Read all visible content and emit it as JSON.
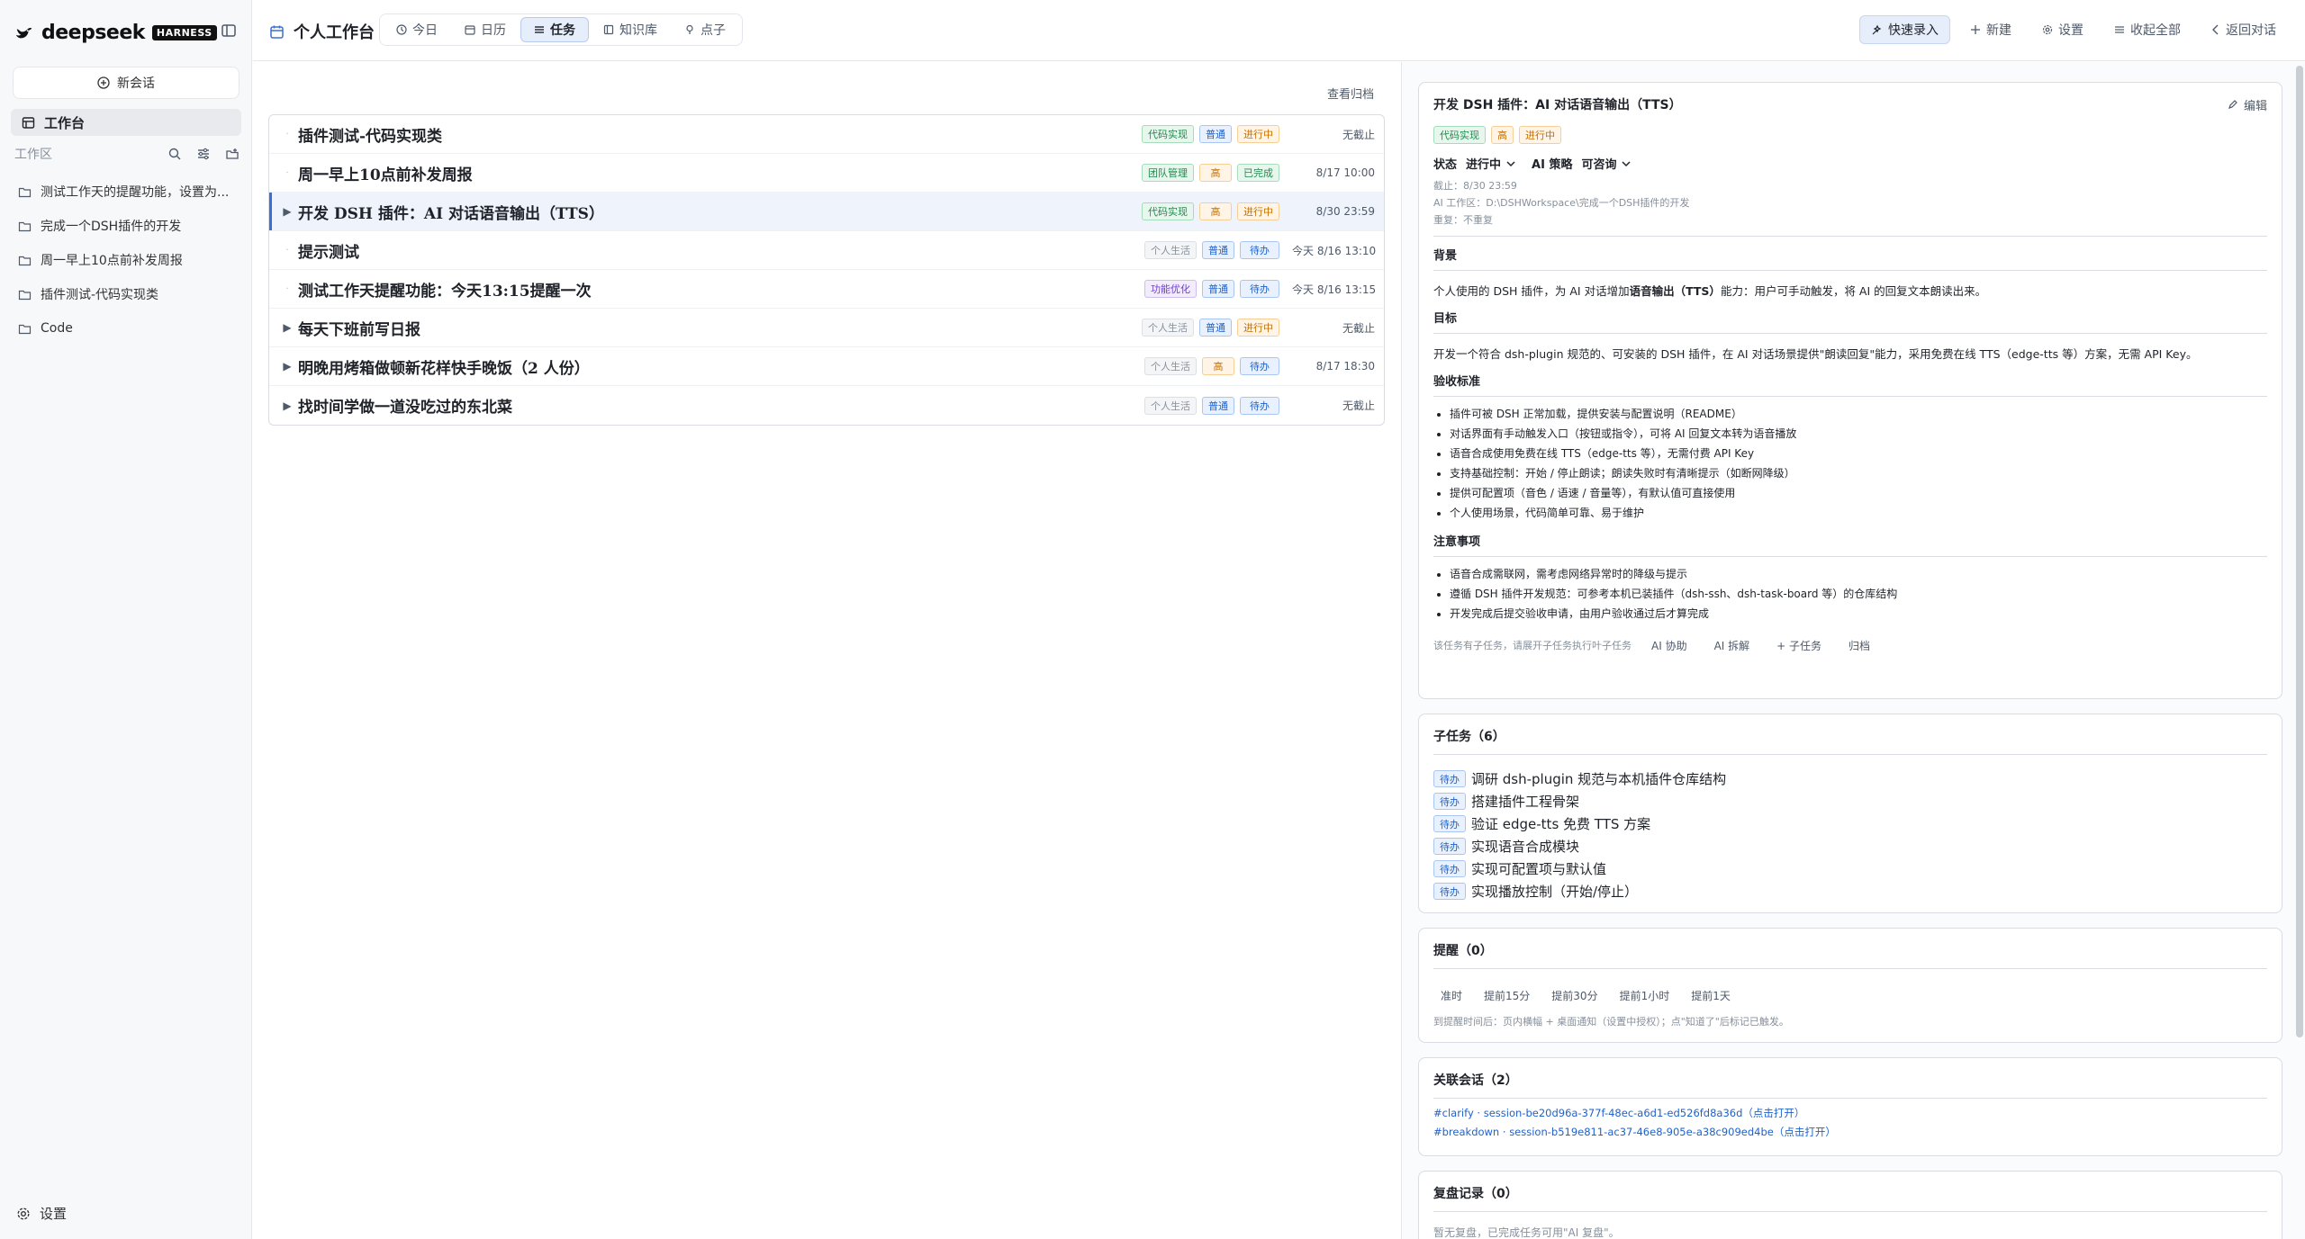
{
  "brand": {
    "name": "deepseek",
    "badge": "HARNESS"
  },
  "sidebar": {
    "new_chat": "新会话",
    "workbench": "工作台",
    "workspace_label": "工作区",
    "items": [
      {
        "label": "测试工作天的提醒功能，设置为..."
      },
      {
        "label": "完成一个DSH插件的开发"
      },
      {
        "label": "周一早上10点前补发周报"
      },
      {
        "label": "插件测试-代码实现类"
      },
      {
        "label": "Code"
      }
    ],
    "settings": "设置"
  },
  "header": {
    "title": "个人工作台",
    "tabs": [
      {
        "label": "今日",
        "icon": "clock-icon"
      },
      {
        "label": "日历",
        "icon": "calendar-icon"
      },
      {
        "label": "任务",
        "icon": "list-icon",
        "active": true
      },
      {
        "label": "知识库",
        "icon": "book-icon"
      },
      {
        "label": "点子",
        "icon": "bulb-icon"
      }
    ],
    "actions": {
      "quick_entry": "快速录入",
      "new": "新建",
      "settings": "设置",
      "collapse": "收起全部",
      "back": "返回对话"
    }
  },
  "tasks": {
    "archive_link": "查看归档",
    "rows": [
      {
        "title": "插件测试-代码实现类",
        "expand": false,
        "tags": [
          {
            "t": "代码实现",
            "c": "green"
          },
          {
            "t": "普通",
            "c": "blue"
          },
          {
            "t": "进行中",
            "c": "orange"
          }
        ],
        "due": "无截止"
      },
      {
        "title": "周一早上10点前补发周报",
        "expand": false,
        "tags": [
          {
            "t": "团队管理",
            "c": "green"
          },
          {
            "t": "高",
            "c": "orange"
          },
          {
            "t": "已完成",
            "c": "green"
          }
        ],
        "due": "8/17 10:00"
      },
      {
        "title": "开发 DSH 插件：AI 对话语音输出（TTS）",
        "expand": true,
        "selected": true,
        "tags": [
          {
            "t": "代码实现",
            "c": "green"
          },
          {
            "t": "高",
            "c": "orange"
          },
          {
            "t": "进行中",
            "c": "orange"
          }
        ],
        "due": "8/30 23:59"
      },
      {
        "title": "提示测试",
        "expand": false,
        "tags": [
          {
            "t": "个人生活",
            "c": "gray"
          },
          {
            "t": "普通",
            "c": "blue"
          },
          {
            "t": "待办",
            "c": "blue"
          }
        ],
        "due": "今天 8/16 13:10"
      },
      {
        "title": "测试工作天提醒功能：今天13:15提醒一次",
        "expand": false,
        "tags": [
          {
            "t": "功能优化",
            "c": "purple"
          },
          {
            "t": "普通",
            "c": "blue"
          },
          {
            "t": "待办",
            "c": "blue"
          }
        ],
        "due": "今天 8/16 13:15"
      },
      {
        "title": "每天下班前写日报",
        "expand": true,
        "tags": [
          {
            "t": "个人生活",
            "c": "gray"
          },
          {
            "t": "普通",
            "c": "blue"
          },
          {
            "t": "进行中",
            "c": "orange"
          }
        ],
        "due": "无截止"
      },
      {
        "title": "明晚用烤箱做顿新花样快手晚饭（2 人份）",
        "expand": true,
        "tags": [
          {
            "t": "个人生活",
            "c": "gray"
          },
          {
            "t": "高",
            "c": "orange"
          },
          {
            "t": "待办",
            "c": "blue"
          }
        ],
        "due": "8/17 18:30"
      },
      {
        "title": "找时间学做一道没吃过的东北菜",
        "expand": true,
        "tags": [
          {
            "t": "个人生活",
            "c": "gray"
          },
          {
            "t": "普通",
            "c": "blue"
          },
          {
            "t": "待办",
            "c": "blue"
          }
        ],
        "due": "无截止"
      }
    ]
  },
  "detail": {
    "title": "开发 DSH 插件：AI 对话语音输出（TTS）",
    "edit": "编辑",
    "tags": [
      {
        "t": "代码实现",
        "c": "green"
      },
      {
        "t": "高",
        "c": "orange"
      },
      {
        "t": "进行中",
        "c": "orange"
      }
    ],
    "status_label": "状态",
    "status_value": "进行中",
    "ai_strategy_label": "AI 策略",
    "ai_strategy_value": "可咨询",
    "meta_due": "截止：8/30 23:59",
    "meta_workspace": "AI 工作区：D:\\DSHWorkspace\\完成一个DSH插件的开发",
    "meta_repeat": "重复：不重复",
    "background_title": "背景",
    "background_pre": "个人使用的 DSH 插件，为 AI 对话增加",
    "background_bold": "语音输出（TTS）",
    "background_post": "能力：用户可手动触发，将 AI 的回复文本朗读出来。",
    "goal_title": "目标",
    "goal_text": "开发一个符合 dsh-plugin 规范的、可安装的 DSH 插件，在 AI 对话场景提供\"朗读回复\"能力，采用免费在线 TTS（edge-tts 等）方案，无需 API Key。",
    "acceptance_title": "验收标准",
    "acceptance": [
      "插件可被 DSH 正常加载，提供安装与配置说明（README）",
      "对话界面有手动触发入口（按钮或指令），可将 AI 回复文本转为语音播放",
      "语音合成使用免费在线 TTS（edge-tts 等），无需付费 API Key",
      "支持基础控制：开始 / 停止朗读；朗读失败时有清晰提示（如断网降级）",
      "提供可配置项（音色 / 语速 / 音量等），有默认值可直接使用",
      "个人使用场景，代码简单可靠、易于维护"
    ],
    "notes_title": "注意事项",
    "notes": [
      "语音合成需联网，需考虑网络异常时的降级与提示",
      "遵循 DSH 插件开发规范：可参考本机已装插件（dsh-ssh、dsh-task-board 等）的仓库结构",
      "开发完成后提交验收申请，由用户验收通过后才算完成"
    ],
    "footer_hint": "该任务有子任务，请展开子任务执行叶子任务",
    "footer_buttons": [
      "AI 协助",
      "AI 拆解",
      "+ 子任务",
      "归档"
    ]
  },
  "subtasks": {
    "title": "子任务（6）",
    "items": [
      {
        "status": "待办",
        "label": "调研 dsh-plugin 规范与本机插件仓库结构"
      },
      {
        "status": "待办",
        "label": "搭建插件工程骨架"
      },
      {
        "status": "待办",
        "label": "验证 edge-tts 免费 TTS 方案"
      },
      {
        "status": "待办",
        "label": "实现语音合成模块"
      },
      {
        "status": "待办",
        "label": "实现可配置项与默认值"
      },
      {
        "status": "待办",
        "label": "实现播放控制（开始/停止）"
      }
    ]
  },
  "reminders": {
    "title": "提醒（0）",
    "buttons": [
      "准时",
      "提前15分",
      "提前30分",
      "提前1小时",
      "提前1天"
    ],
    "hint": "到提醒时间后：页内横幅 + 桌面通知（设置中授权）；点\"知道了\"后标记已触发。"
  },
  "conversations": {
    "title": "关联会话（2）",
    "links": [
      "#clarify · session-be20d96a-377f-48ec-a6d1-ed526fd8a36d（点击打开）",
      "#breakdown · session-b519e811-ac37-46e8-905e-a38c909ed4be（点击打开）"
    ]
  },
  "review": {
    "title": "复盘记录（0）",
    "empty": "暂无复盘，已完成任务可用\"AI 复盘\"。"
  },
  "colors": {
    "accent": "#3b6fd8",
    "accent_bg": "#e6eefb",
    "border": "#d9dce1"
  }
}
